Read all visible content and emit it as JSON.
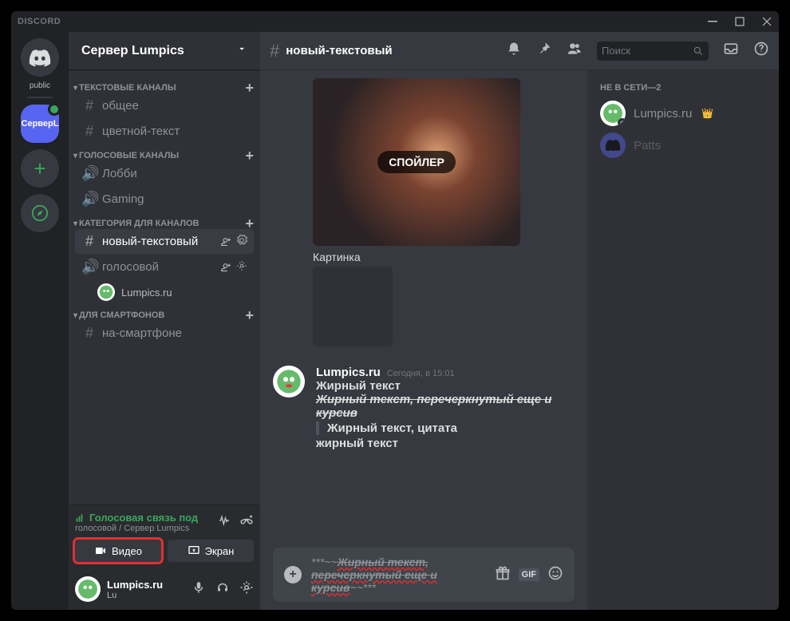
{
  "app_name": "DISCORD",
  "server": {
    "name": "Сервер Lumpics",
    "public_tag": "public",
    "short": "СерверL"
  },
  "categories": {
    "text": {
      "label": "ТЕКСТОВЫЕ КАНАЛЫ",
      "channels": [
        "общее",
        "цветной-текст"
      ]
    },
    "voice": {
      "label": "ГОЛОСОВЫЕ КАНАЛЫ",
      "channels": [
        "Лобби",
        "Gaming"
      ]
    },
    "custom": {
      "label": "КАТЕГОРИЯ ДЛЯ КАНАЛОВ",
      "text_channel": "новый-текстовый",
      "voice_channel": "голосовой",
      "voice_user": "Lumpics.ru"
    },
    "mobile": {
      "label": "ДЛЯ СМАРТФОНОВ",
      "channel": "на-смартфоне"
    }
  },
  "voice_panel": {
    "status": "Голосовая связь под",
    "sub": "голосовой / Сервер Lumpics",
    "video_btn": "Видео",
    "screen_btn": "Экран"
  },
  "user_area": {
    "name": "Lumpics.ru",
    "tag": "Lu"
  },
  "chat": {
    "channel": "новый-текстовый",
    "search_placeholder": "Поиск",
    "spoiler_label": "СПОЙЛЕР",
    "caption": "Картинка",
    "message": {
      "author": "Lumpics.ru",
      "timestamp": "Сегодня, в 15:01",
      "line1": "Жирный текст",
      "line2": "Жирный текст, перечеркнутый еще и курсив",
      "line3": "Жирный текст, цитата",
      "line4": "жирный текст"
    },
    "compose": {
      "prefix": "***~~",
      "part1": "Жирный текст, перечеркнутый еще ",
      "part2": "и курсив",
      "suffix": "~~***",
      "gif": "GIF"
    }
  },
  "members": {
    "header": "НЕ В СЕТИ—2",
    "list": [
      {
        "name": "Lumpics.ru",
        "owner": true
      },
      {
        "name": "Patts",
        "owner": false
      }
    ]
  }
}
